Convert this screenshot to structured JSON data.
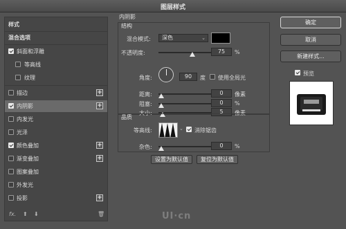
{
  "window": {
    "title": "图层样式"
  },
  "left_panel": {
    "items": [
      {
        "label": "样式",
        "type": "header"
      },
      {
        "label": "混合选项",
        "type": "header"
      },
      {
        "label": "斜面和浮雕",
        "checked": true,
        "indent": 0
      },
      {
        "label": "等高线",
        "checked": false,
        "indent": 1
      },
      {
        "label": "纹理",
        "checked": false,
        "indent": 1
      },
      {
        "label": "描边",
        "checked": false,
        "indent": 0,
        "plus": true
      },
      {
        "label": "内阴影",
        "checked": true,
        "indent": 0,
        "plus": true,
        "selected": true
      },
      {
        "label": "内发光",
        "checked": false,
        "indent": 0
      },
      {
        "label": "光泽",
        "checked": false,
        "indent": 0
      },
      {
        "label": "颜色叠加",
        "checked": true,
        "indent": 0,
        "plus": true
      },
      {
        "label": "渐变叠加",
        "checked": false,
        "indent": 0,
        "plus": true
      },
      {
        "label": "图案叠加",
        "checked": false,
        "indent": 0
      },
      {
        "label": "外发光",
        "checked": false,
        "indent": 0
      },
      {
        "label": "投影",
        "checked": false,
        "indent": 0,
        "plus": true
      }
    ],
    "footer": {
      "fx": "fx.",
      "up": "⬆",
      "down": "⬇",
      "trash": "🗑"
    }
  },
  "inner_shadow": {
    "title": "内阴影",
    "structure": {
      "title": "结构",
      "blend_mode_label": "混合模式:",
      "blend_mode_value": "深色",
      "blend_color": "#000000",
      "opacity_label": "不透明度:",
      "opacity_value": "75",
      "opacity_unit": "%",
      "angle_label": "角度:",
      "angle_value": "90",
      "angle_unit": "度",
      "global_light_label": "使用全局光",
      "global_light_checked": false,
      "distance_label": "距离:",
      "distance_value": "0",
      "distance_unit": "像素",
      "choke_label": "阻塞:",
      "choke_value": "0",
      "choke_unit": "%",
      "size_label": "大小:",
      "size_value": "5",
      "size_unit": "像素"
    },
    "quality": {
      "title": "品质",
      "contour_label": "等高线:",
      "antialias_label": "消除锯齿",
      "antialias_checked": true,
      "noise_label": "杂色:",
      "noise_value": "0",
      "noise_unit": "%"
    },
    "set_default_label": "设置为默认值",
    "reset_default_label": "复位为默认值"
  },
  "right_panel": {
    "ok_label": "确定",
    "cancel_label": "取消",
    "new_style_label": "新建样式...",
    "preview_label": "预览",
    "preview_checked": true
  },
  "watermark": "UI·cn"
}
